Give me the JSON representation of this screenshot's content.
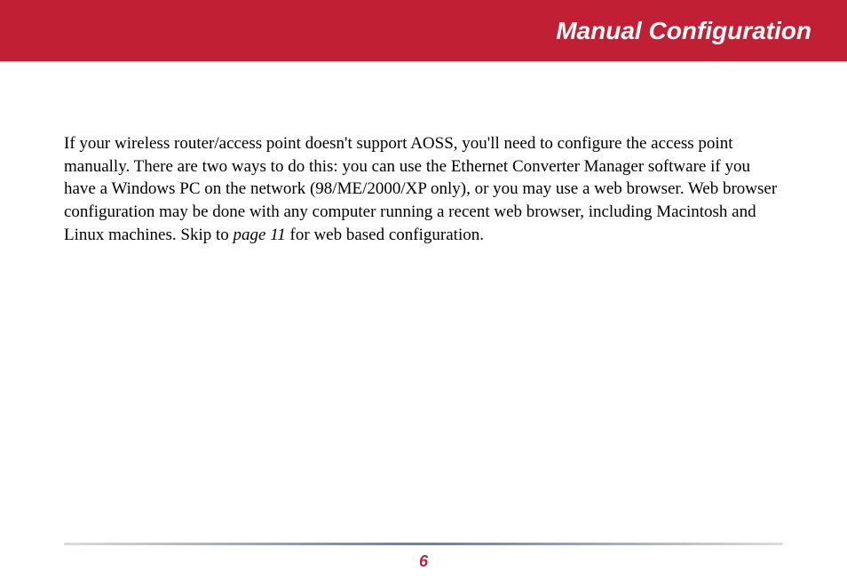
{
  "header": {
    "title": "Manual Configuration"
  },
  "content": {
    "paragraph_part1": "If your wireless router/access point doesn't support AOSS, you'll need to configure the access point manually.  There are two ways to do this:  you can use the Ethernet Converter Manager software if you have a Windows PC on the network (98/ME/2000/XP only), or you may use a web browser.  Web browser configuration may be done with any computer running a recent web browser, including Macintosh and Linux machines. Skip to ",
    "page_reference": "page 11",
    "paragraph_part2": " for web based configuration."
  },
  "footer": {
    "page_number": "6"
  }
}
